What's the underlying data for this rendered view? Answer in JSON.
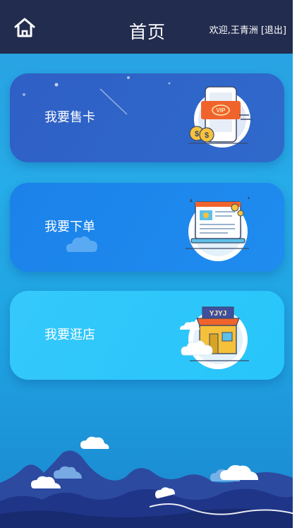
{
  "header": {
    "title": "首页",
    "welcome": "欢迎,王青洲",
    "logout": "[退出]"
  },
  "cards": [
    {
      "label": "我要售卡",
      "icon": "vip-card-icon",
      "color": "#2f64c8"
    },
    {
      "label": "我要下单",
      "icon": "laptop-order-icon",
      "color": "#1b86eb"
    },
    {
      "label": "我要逛店",
      "icon": "store-icon",
      "color": "#30c7fb"
    }
  ],
  "illustrations": {
    "store_sign": "YJYJ"
  },
  "colors": {
    "header_bg": "#222c4e",
    "page_bg": "#26ace8"
  }
}
